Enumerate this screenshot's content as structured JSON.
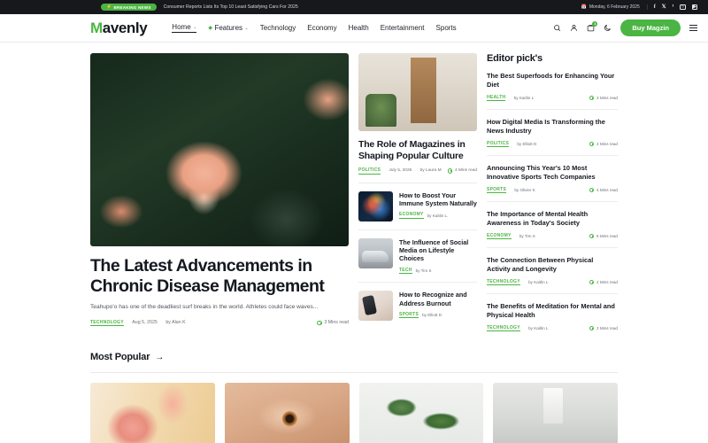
{
  "topbar": {
    "breaking_label": "BREAKING NEWS",
    "breaking_icon": "bolt-icon",
    "headline": "Consumer Reports Lists Its Top 10 Least Satisfying Cars For 2025",
    "date": "Monday, 6 February 2025",
    "calendar_icon": "calendar-icon",
    "social": [
      {
        "name": "facebook-icon",
        "glyph": "f"
      },
      {
        "name": "x-twitter-icon",
        "glyph": "✕"
      },
      {
        "name": "pinterest-icon",
        "glyph": "ᴾ"
      },
      {
        "name": "instagram-icon",
        "glyph": "◉"
      },
      {
        "name": "youtube-icon",
        "glyph": "▶"
      }
    ]
  },
  "nav": {
    "logo_mark": "M",
    "logo_rest": "avenly",
    "menu": [
      {
        "label": "Home",
        "caret": "⌄",
        "active": true
      },
      {
        "label": "Features",
        "caret": "⌄",
        "diamond": true
      },
      {
        "label": "Technology"
      },
      {
        "label": "Economy"
      },
      {
        "label": "Health"
      },
      {
        "label": "Entertainment"
      },
      {
        "label": "Sports"
      }
    ],
    "search_icon": "search-icon",
    "account_icon": "user-icon",
    "cart_icon": "cart-icon",
    "cart_count": "1",
    "theme_icon": "moon-icon",
    "buy_label": "Buy Magzin",
    "menu_icon": "hamburger-icon"
  },
  "hero": {
    "image": "pink-calla-lily-photo",
    "title": "The Latest Advancements in Chronic Disease Management",
    "excerpt": "Teahupo’o has one of the deadliest surf breaks in the world. Athletes could face waves...",
    "category": "TECHNOLOGY",
    "date": "Aug 5, 2025",
    "author": "by Alan K",
    "readtime": "3 Mins read"
  },
  "feature": {
    "image": "garden-shed-doorway-photo",
    "title": "The Role of Magazines in Shaping Popular Culture",
    "category": "POLITICS",
    "date": "July 5, 2025",
    "author": "by Laura M",
    "readtime": "4 Mins read"
  },
  "list": [
    {
      "title": "How to Boost Your Immune System Naturally",
      "category": "ECONOMY",
      "author": "by Kaitlin L.",
      "image": "immune-cells-photo"
    },
    {
      "title": "The Influence of Social Media on Lifestyle Choices",
      "category": "TECH",
      "author": "by Tim S",
      "image": "white-van-photo"
    },
    {
      "title": "How to Recognize and Address Burnout",
      "category": "SPORTS",
      "author": "by Elliott D",
      "image": "phone-on-desk-photo"
    }
  ],
  "editor_picks": {
    "heading": "Editor pick's",
    "items": [
      {
        "title": "The Best Superfoods for Enhancing Your Diet",
        "category": "HEALTH",
        "author": "by Kaitlin L",
        "readtime": "3 Mins read"
      },
      {
        "title": "How Digital Media Is Transforming the News Industry",
        "category": "POLITICS",
        "author": "by Elliott D",
        "readtime": "2 Mins read"
      },
      {
        "title": "Announcing This Year's 10 Most Innovative Sports Tech Companies",
        "category": "SPORTS",
        "author": "by Olivier K",
        "readtime": "4 Mins read"
      },
      {
        "title": "The Importance of Mental Health Awareness in Today's Society",
        "category": "ECONOMY",
        "author": "by Tim S",
        "readtime": "5 Mins read"
      },
      {
        "title": "The Connection Between Physical Activity and Longevity",
        "category": "TECHNOLOGY",
        "author": "by Kaitlin L",
        "readtime": "2 Mins read"
      },
      {
        "title": "The Benefits of Meditation for Mental and Physical Health",
        "category": "TECHNOLOGY",
        "author": "by Kaitlin L",
        "readtime": "2 Mins read"
      }
    ]
  },
  "most_popular": {
    "heading": "Most Popular",
    "arrow": "→",
    "cards": [
      {
        "image": "pink-tulips-photo"
      },
      {
        "image": "brown-eye-closeup-photo"
      },
      {
        "image": "green-leaves-photo"
      },
      {
        "image": "cosmetics-bottles-photo"
      }
    ]
  },
  "colors": {
    "accent": "#4bb543",
    "dark": "#16181c",
    "text": "#14181f",
    "muted": "#6b7078"
  }
}
